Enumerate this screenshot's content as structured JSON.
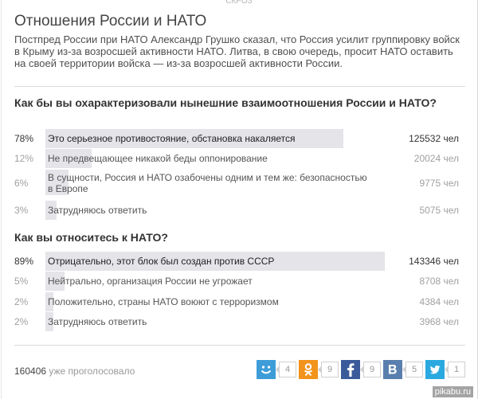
{
  "top_cut": "СКРОЗ",
  "title": "Отношения России и НАТО",
  "lead": "Постпред России при НАТО Александр Грушко сказал, что Россия усилит группировку войск в Крыму из-за возросшей активности НАТО. Литва, в свою очередь, просит НАТО оставить на своей территории войска — из-за возросшей активности России.",
  "polls": [
    {
      "question": "Как бы вы охарактеризовали нынешние взаимоотношения России и НАТО?",
      "answers": [
        {
          "pct": "78%",
          "label": "Это серьезное противостояние, обстановка накаляется",
          "count": "125532 чел",
          "share": 0.78
        },
        {
          "pct": "12%",
          "label": "Не предвещающее никакой беды оппонирование",
          "count": "20024 чел",
          "share": 0.12
        },
        {
          "pct": "6%",
          "label": "В сущности, Россия и НАТО озабочены одним и тем же: безопасностью в Европе",
          "count": "9775 чел",
          "share": 0.06
        },
        {
          "pct": "3%",
          "label": "Затрудняюсь ответить",
          "count": "5075 чел",
          "share": 0.03
        }
      ]
    },
    {
      "question": "Как вы относитесь к НАТО?",
      "answers": [
        {
          "pct": "89%",
          "label": "Отрицательно, этот блок был создан против СССР",
          "count": "143346 чел",
          "share": 0.89
        },
        {
          "pct": "5%",
          "label": "Нейтрально, организация России не угрожает",
          "count": "8708 чел",
          "share": 0.05
        },
        {
          "pct": "2%",
          "label": "Положительно, страны НАТО воюют с терроризмом",
          "count": "4384 чел",
          "share": 0.02
        },
        {
          "pct": "2%",
          "label": "Затрудняюсь ответить",
          "count": "3968 чел",
          "share": 0.02
        }
      ]
    }
  ],
  "total": {
    "count": "160406",
    "suffix": "уже проголосовало"
  },
  "share": [
    {
      "name": "moimir",
      "icon": "smile-icon",
      "color": "#3e9dd9",
      "count": "4"
    },
    {
      "name": "odnoklassniki",
      "icon": "ok-icon",
      "color": "#f2931c",
      "count": "9"
    },
    {
      "name": "facebook",
      "icon": "facebook-icon",
      "color": "#3b5a9a",
      "count": "9"
    },
    {
      "name": "vkontakte",
      "icon": "vk-icon",
      "color": "#5a7fae",
      "count": "5"
    },
    {
      "name": "twitter",
      "icon": "twitter-icon",
      "color": "#2aa9e0",
      "count": "1"
    }
  ],
  "watermark": "pikabu.ru"
}
